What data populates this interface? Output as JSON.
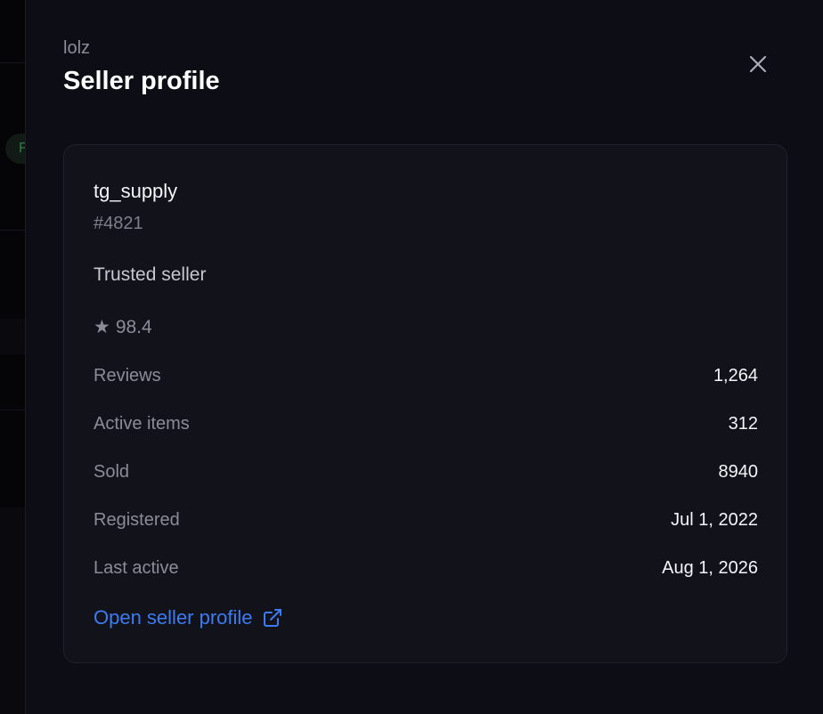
{
  "header": {
    "subtitle": "lolz",
    "title": "Seller profile",
    "close_icon": "close-icon"
  },
  "background": {
    "chip_letter": "F"
  },
  "seller": {
    "name": "tg_supply",
    "id": "#4821",
    "badge": "Trusted seller",
    "rating_icon": "star-icon",
    "rating": "98.4",
    "stats": [
      {
        "label": "Reviews",
        "value": "1,264"
      },
      {
        "label": "Active items",
        "value": "312"
      },
      {
        "label": "Sold",
        "value": "8940"
      },
      {
        "label": "Registered",
        "value": "Jul 1, 2022"
      },
      {
        "label": "Last active",
        "value": "Aug 1, 2026"
      }
    ],
    "link_label": "Open seller profile",
    "link_icon": "external-link-icon"
  },
  "colors": {
    "background": "#0d0d15",
    "card": "#11121a",
    "accent": "#3d7bf2",
    "text_primary": "#f4f5f8",
    "text_muted": "#8a8d98"
  }
}
